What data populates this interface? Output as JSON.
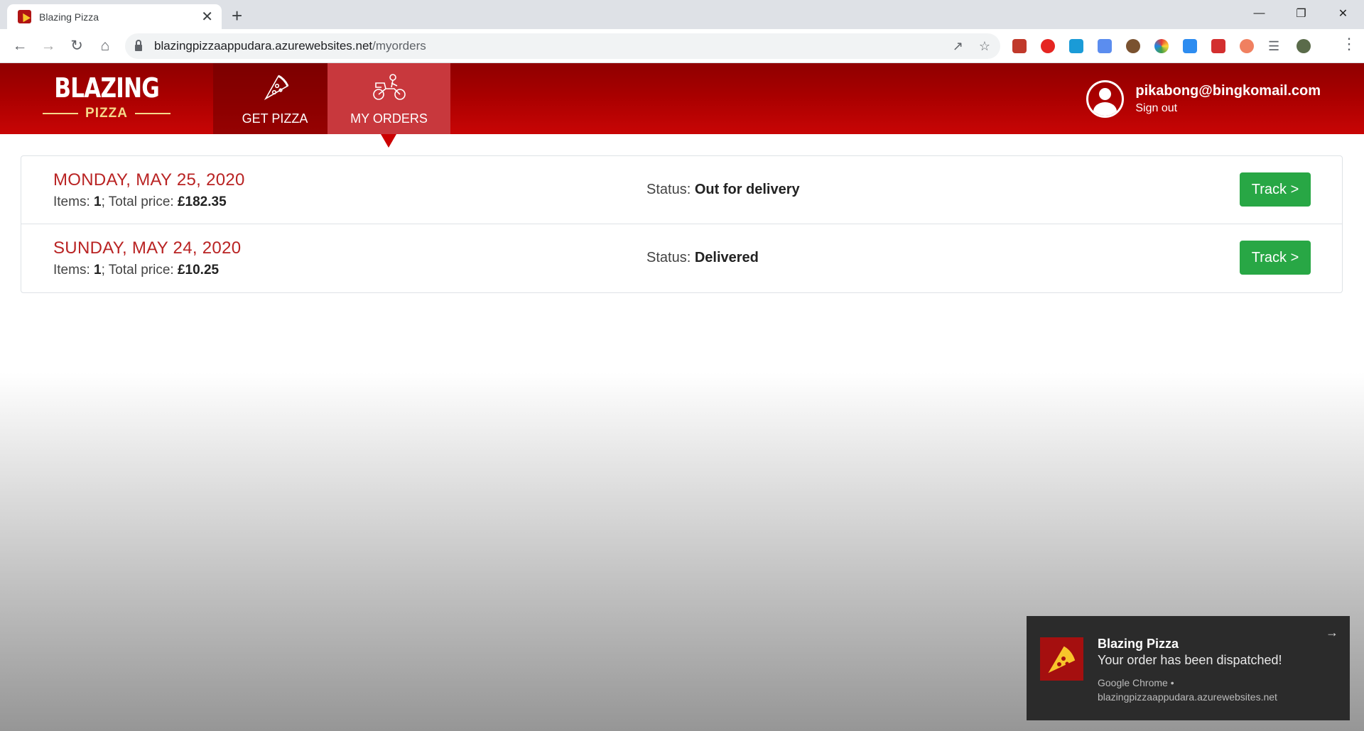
{
  "browser": {
    "tab_title": "Blazing Pizza",
    "url_host": "blazingpizzaappudara.azurewebsites.net",
    "url_path": "/myorders"
  },
  "header": {
    "logo_main": "BLAZING",
    "logo_sub": "PIZZA",
    "nav": [
      {
        "label": "GET PIZZA",
        "icon": "pizza-slice-icon"
      },
      {
        "label": "MY ORDERS",
        "icon": "delivery-scooter-icon",
        "active": true
      }
    ],
    "user_email": "pikabong@bingkomail.com",
    "sign_out": "Sign out"
  },
  "orders": [
    {
      "date": "MONDAY, MAY 25, 2020",
      "items_label": "Items:",
      "items": "1",
      "price_label": "; Total price:",
      "price": "£182.35",
      "status_label": "Status:",
      "status": "Out for delivery",
      "track_label": "Track >"
    },
    {
      "date": "SUNDAY, MAY 24, 2020",
      "items_label": "Items:",
      "items": "1",
      "price_label": "; Total price:",
      "price": "£10.25",
      "status_label": "Status:",
      "status": "Delivered",
      "track_label": "Track >"
    }
  ],
  "notification": {
    "title": "Blazing Pizza",
    "message": "Your order has been dispatched!",
    "source": "Google Chrome •",
    "source_url": "blazingpizzaappudara.azurewebsites.net"
  },
  "colors": {
    "brand_red": "#b00000",
    "date_red": "#b92323",
    "track_green": "#28a745",
    "toast_bg": "#2b2b2b"
  }
}
